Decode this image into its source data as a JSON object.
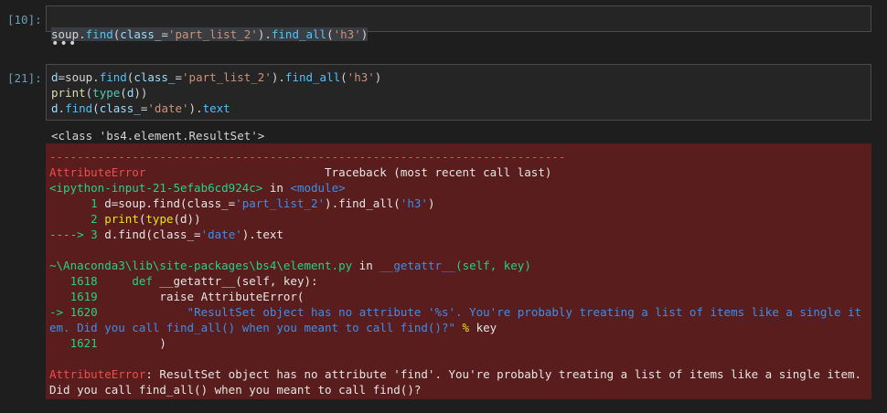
{
  "cells": [
    {
      "prompt": "[10]:",
      "source": [
        "soup.find(class_='part_list_2').find_all('h3')"
      ],
      "collapsed_output": "•••"
    },
    {
      "prompt": "[21]:",
      "source": [
        "d=soup.find(class_='part_list_2').find_all('h3')",
        "print(type(d))",
        "d.find(class_='date').text"
      ],
      "stdout": "<class 'bs4.element.ResultSet'>",
      "error": {
        "separator": "---------------------------------------------------------------------------",
        "ename": "AttributeError",
        "traceback_header": "Traceback (most recent call last)",
        "frame1": {
          "location": "<ipython-input-21-5efab6cd924c>",
          "in": "in",
          "module": "<module>",
          "lines": [
            {
              "arrow": "",
              "num": "1",
              "code": "d=soup.find(class_='part_list_2').find_all('h3')"
            },
            {
              "arrow": "",
              "num": "2",
              "code": "print(type(d))"
            },
            {
              "arrow": "---->",
              "num": "3",
              "code": "d.find(class_='date').text"
            }
          ]
        },
        "frame2": {
          "path": "~\\Anaconda3\\lib\\site-packages\\bs4\\element.py",
          "in": "in",
          "func": "__getattr__",
          "args": "(self, key)",
          "lines": [
            {
              "arrow": "",
              "num": "1618",
              "code": "def __getattr__(self, key):"
            },
            {
              "arrow": "",
              "num": "1619",
              "code": "raise AttributeError("
            },
            {
              "arrow": "->",
              "num": "1620",
              "code": "\"ResultSet object has no attribute '%s'. You're probably treating a list of items like a single item. Did you call find_all() when you meant to call find()?\" % key"
            },
            {
              "arrow": "",
              "num": "1621",
              "code": ")"
            }
          ]
        },
        "final_message": "ResultSet object has no attribute 'find'. You're probably treating a list of items like a single item. Did you call find_all() when you meant to call find()?"
      }
    }
  ]
}
